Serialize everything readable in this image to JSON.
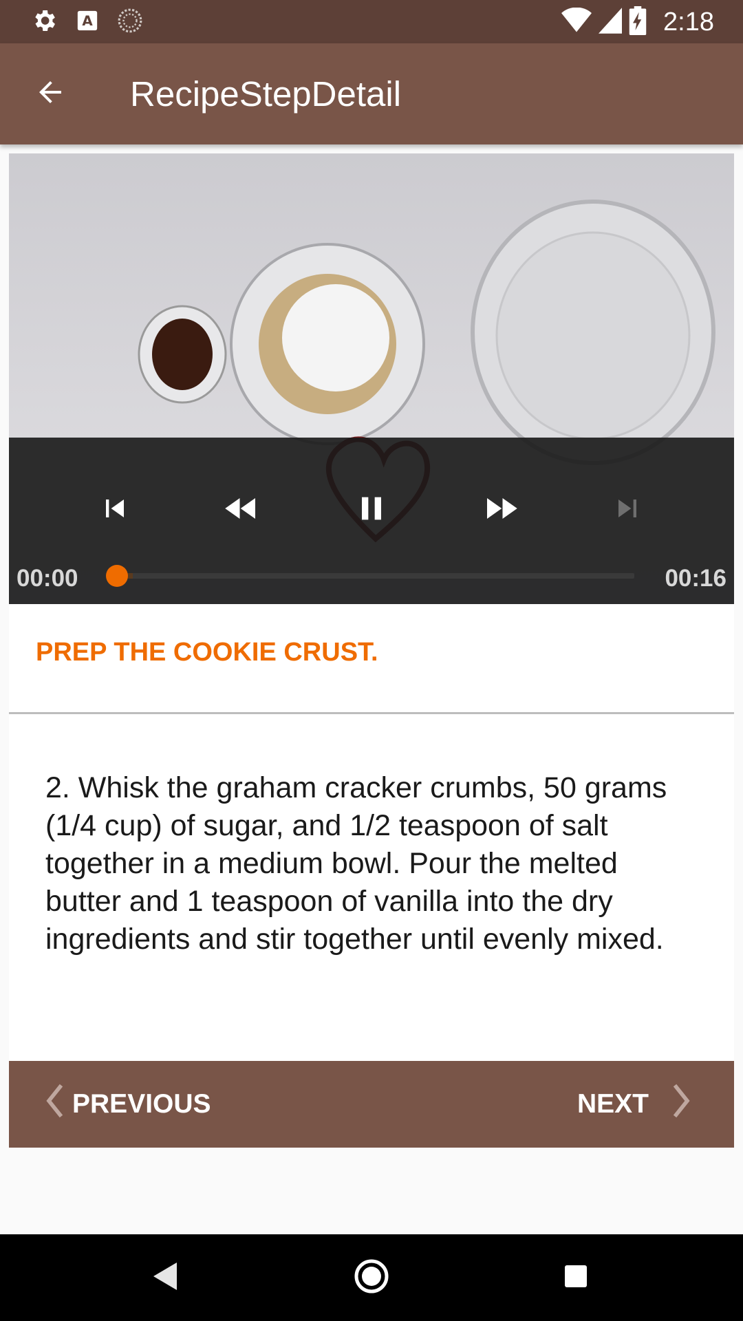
{
  "status_bar": {
    "time": "2:18",
    "icons_left": [
      "settings-icon",
      "keyboard-a-icon",
      "sync-icon"
    ],
    "icons_right": [
      "wifi-icon",
      "signal-icon",
      "battery-charging-icon"
    ]
  },
  "app_bar": {
    "title": "RecipeStepDetail",
    "back_icon": "arrow-back-icon"
  },
  "player": {
    "current_time": "00:00",
    "duration": "00:16",
    "progress": 0.0,
    "buffered": 0.03,
    "controls": [
      "skip-previous-icon",
      "rewind-icon",
      "pause-icon",
      "fast-forward-icon",
      "skip-next-icon"
    ],
    "accent_color": "#ef6c00"
  },
  "step": {
    "short_description": "PREP THE COOKIE CRUST.",
    "description": "2. Whisk the graham cracker crumbs, 50 grams (1/4 cup) of sugar, and 1/2 teaspoon of salt together in a medium bowl. Pour the melted butter and 1 teaspoon of vanilla into the dry ingredients and stir together until evenly mixed."
  },
  "navigation": {
    "previous_label": "PREVIOUS",
    "next_label": "NEXT",
    "bar_color": "#795548"
  },
  "system_nav": [
    "back-triangle-icon",
    "home-circle-icon",
    "recents-square-icon"
  ]
}
